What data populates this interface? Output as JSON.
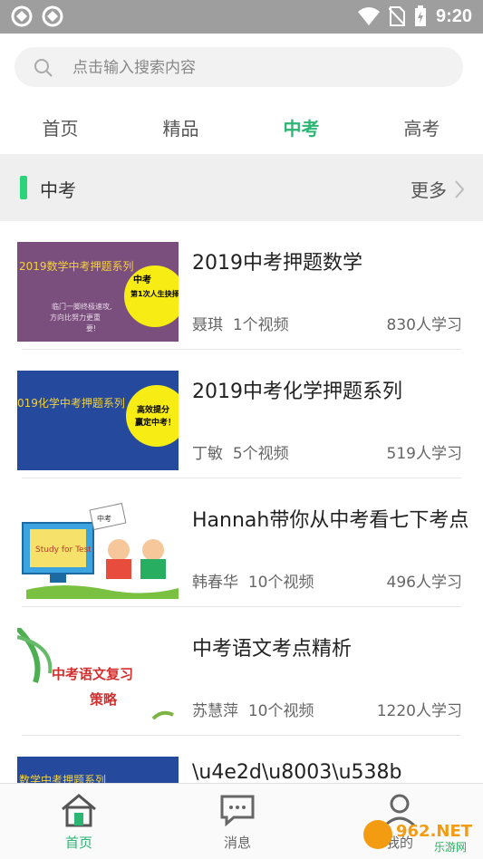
{
  "status_bar": {
    "time": "9:20"
  },
  "search": {
    "placeholder": "点击输入搜索内容"
  },
  "tabs": [
    {
      "label": "首页",
      "active": false
    },
    {
      "label": "精品",
      "active": false
    },
    {
      "label": "中考",
      "active": true
    },
    {
      "label": "高考",
      "active": false
    }
  ],
  "section": {
    "title": "中考",
    "more_label": "更多"
  },
  "courses": [
    {
      "title": "2019中考押题数学",
      "teacher": "聂琪",
      "videos": "1个视频",
      "learners": "830人学习",
      "thumb": {
        "banner": "2019数学中考押题系列",
        "circle_small": "中考",
        "circle_line": "第1次人生抉择！",
        "body_lines": [
          "临门一脚终极速攻,",
          "方向比努力更重",
          "要!"
        ]
      }
    },
    {
      "title": "2019中考化学押题系列",
      "teacher": "丁敏",
      "videos": "5个视频",
      "learners": "519人学习",
      "thumb": {
        "banner": "019化学中考押题系列",
        "circle_lines": [
          "高效提分",
          "赢定中考！"
        ]
      }
    },
    {
      "title": "Hannah带你从中考看七下考点",
      "teacher": "韩春华",
      "videos": "10个视频",
      "learners": "496人学习",
      "thumb": {
        "screen_text": "Study for Test",
        "note_text": "中考"
      }
    },
    {
      "title": "中考语文考点精析",
      "teacher": "苏慧萍",
      "videos": "10个视频",
      "learners": "1220人学习",
      "thumb": {
        "line1": "中考语文复习",
        "line2": "策略"
      }
    },
    {
      "title": "\\u4e2d\\u8003\\u538b",
      "thumb": {
        "banner": "数学中考押题系列"
      }
    }
  ],
  "bottom_nav": [
    {
      "label": "首页",
      "active": true
    },
    {
      "label": "消息",
      "active": false
    },
    {
      "label": "我的",
      "active": false
    }
  ],
  "watermark": {
    "brand": "962.NET",
    "sub": "乐游网"
  },
  "colors": {
    "accent": "#2bb673",
    "status_bar": "#9e9e9e"
  }
}
